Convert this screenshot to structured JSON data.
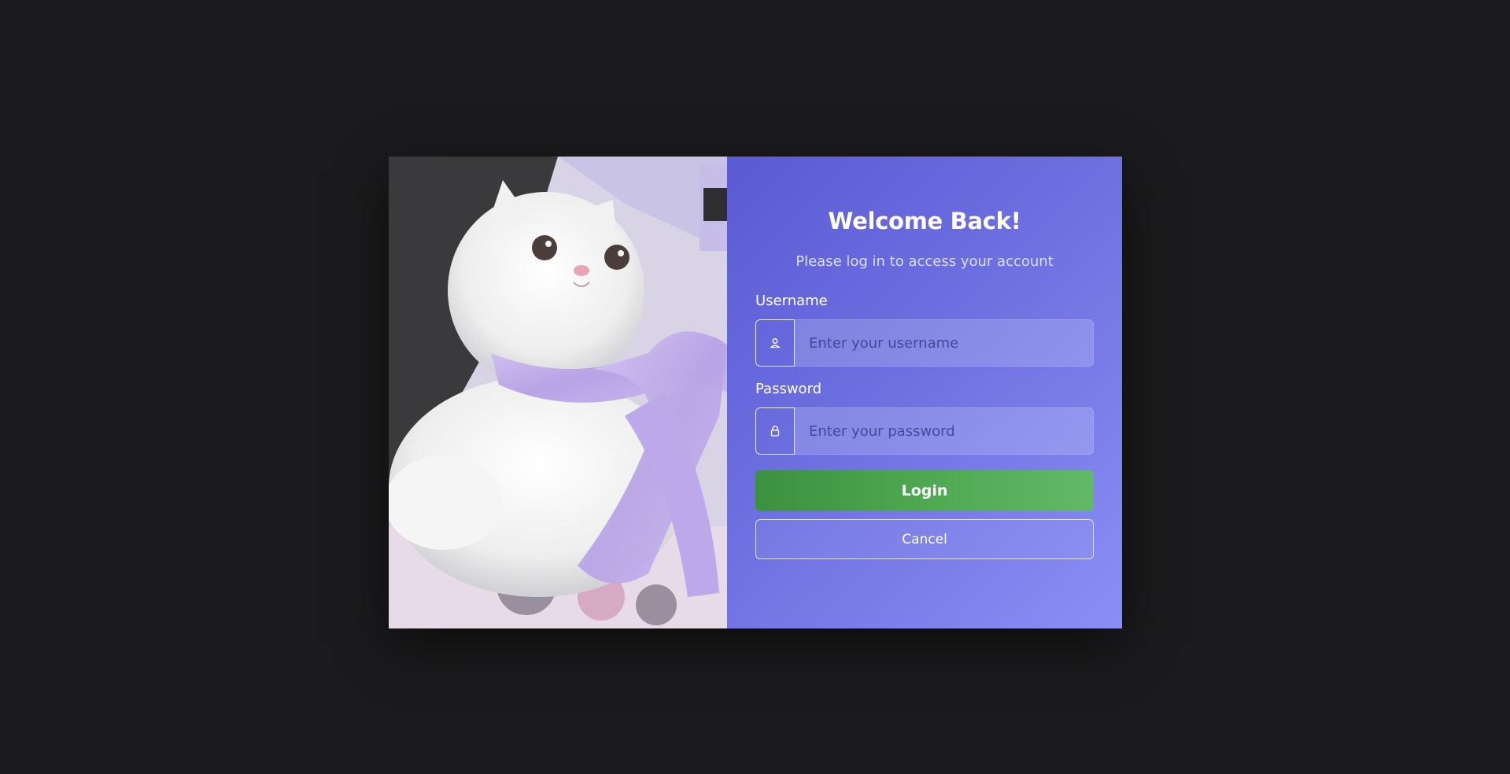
{
  "photo": {
    "description_icon": "cat-photo"
  },
  "login": {
    "title": "Welcome Back!",
    "subtitle": "Please log in to access your account",
    "username_label": "Username",
    "username_placeholder": "Enter your username",
    "username_value": "",
    "password_label": "Password",
    "password_placeholder": "Enter your password",
    "password_value": "",
    "login_button": "Login",
    "cancel_button": "Cancel"
  },
  "icons": {
    "username": "user-icon",
    "password": "lock-icon"
  },
  "colors": {
    "page_background": "#1b1b1d",
    "panel_gradient_start": "#5a5bd3",
    "panel_gradient_end": "#8a8ef4",
    "login_button": "#4ea851"
  }
}
